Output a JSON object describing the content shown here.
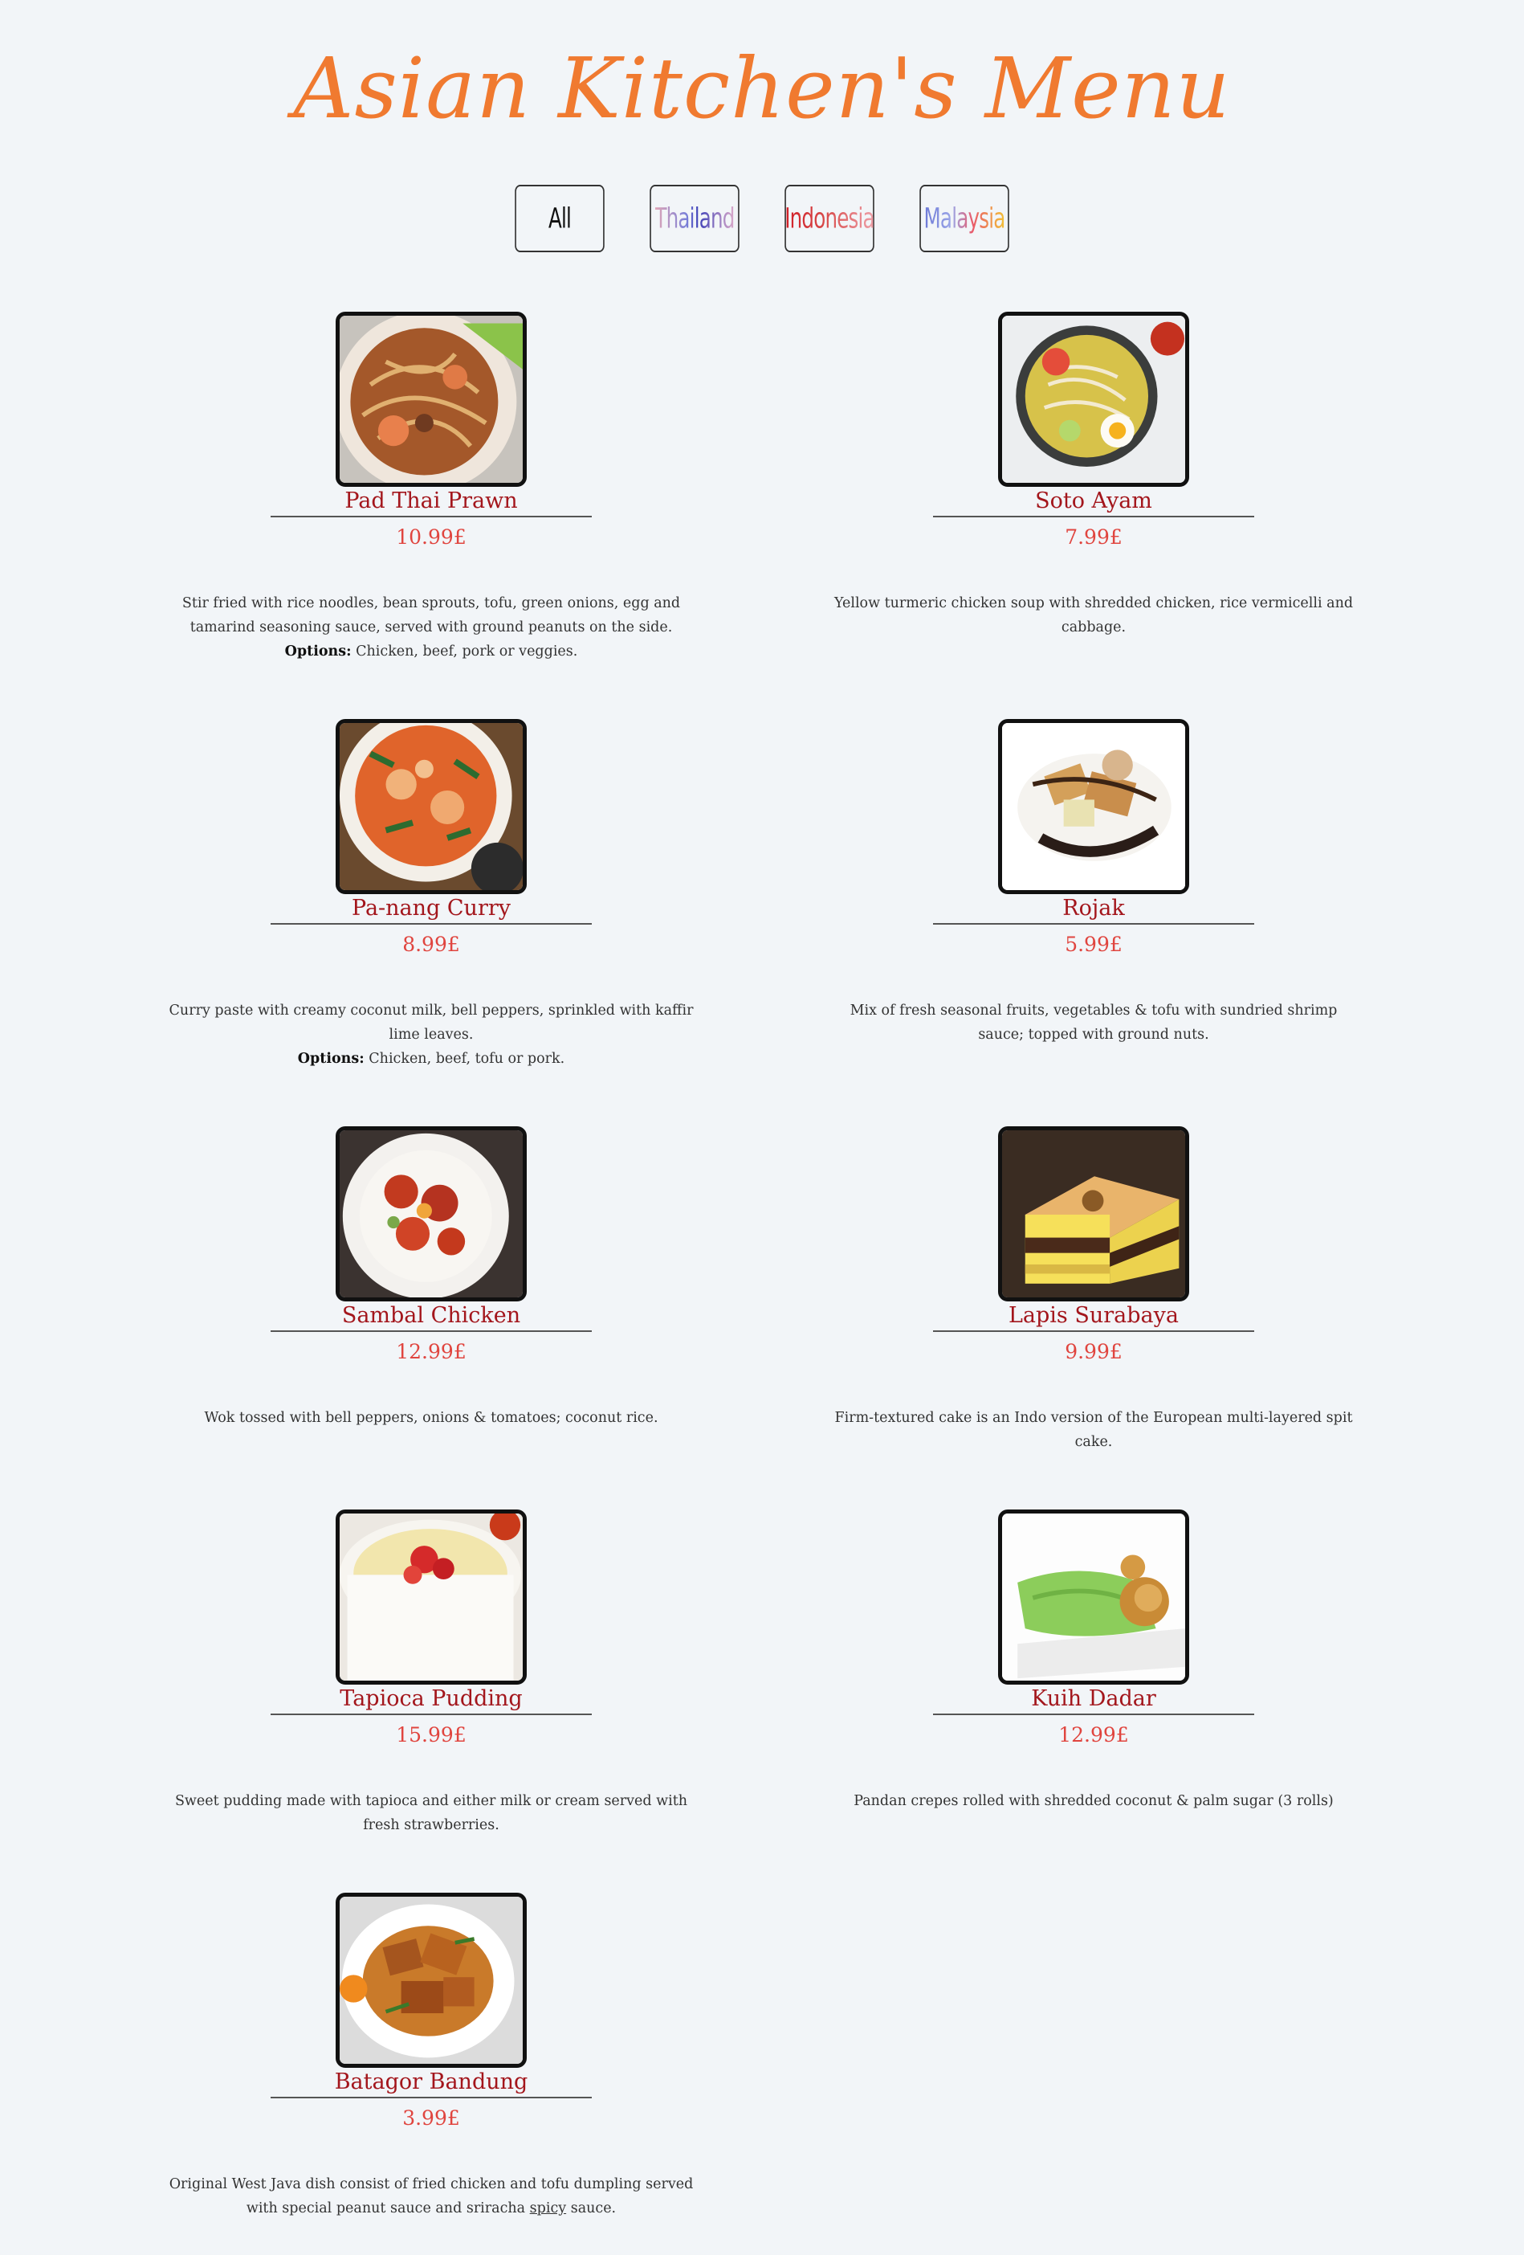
{
  "page": {
    "title": "Asian Kitchen's Menu"
  },
  "filters": [
    {
      "label": "All"
    },
    {
      "label": "Thailand"
    },
    {
      "label": "Indonesia"
    },
    {
      "label": "Malaysia"
    }
  ],
  "items": [
    {
      "name": "Pad Thai Prawn",
      "price": "10.99£",
      "description": "Stir fried with rice noodles, bean sprouts, tofu, green onions, egg and tamarind seasoning sauce, served with ground peanuts on the side.",
      "options_label": "Options:",
      "options": "Chicken, beef, pork or veggies."
    },
    {
      "name": "Soto Ayam",
      "price": "7.99£",
      "description": "Yellow turmeric chicken soup with shredded chicken, rice vermicelli and cabbage."
    },
    {
      "name": "Pa-nang Curry",
      "price": "8.99£",
      "description": "Curry paste with creamy coconut milk, bell peppers, sprinkled with kaffir lime leaves.",
      "options_label": "Options:",
      "options": "Chicken, beef, tofu or pork."
    },
    {
      "name": "Rojak",
      "price": "5.99£",
      "description": "Mix of fresh seasonal fruits, vegetables & tofu with sundried shrimp sauce; topped with ground nuts."
    },
    {
      "name": "Sambal Chicken",
      "price": "12.99£",
      "description": "Wok tossed with bell peppers, onions & tomatoes; coconut rice."
    },
    {
      "name": "Lapis Surabaya",
      "price": "9.99£",
      "description": "Firm-textured cake is an Indo version of the European multi-layered spit cake."
    },
    {
      "name": "Tapioca Pudding",
      "price": "15.99£",
      "description": "Sweet pudding made with tapioca and either milk or cream served with fresh strawberries."
    },
    {
      "name": "Kuih Dadar",
      "price": "12.99£",
      "description": "Pandan crepes rolled with shredded coconut & palm sugar (3 rolls)"
    },
    {
      "name": "Batagor Bandung",
      "price": "3.99£",
      "description_before": "Original West Java dish consist of fried chicken and tofu dumpling served with special peanut sauce and sriracha",
      "description_spicy": "spicy",
      "description_after": "sauce."
    }
  ]
}
